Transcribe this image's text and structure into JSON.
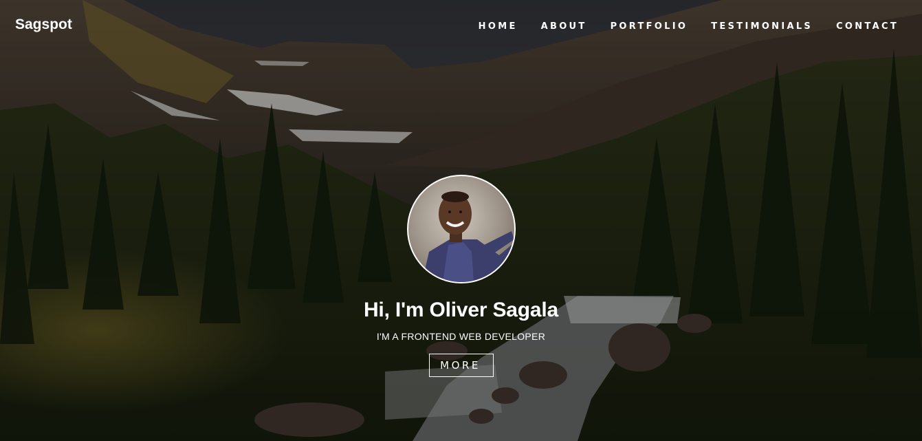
{
  "brand": {
    "name": "Sagspot"
  },
  "nav": {
    "items": [
      {
        "label": "HOME"
      },
      {
        "label": "ABOUT"
      },
      {
        "label": "PORTFOLIO"
      },
      {
        "label": "TESTIMONIALS"
      },
      {
        "label": "CONTACT"
      }
    ]
  },
  "hero": {
    "background": "mountain-forest-waterfall-photo",
    "headline": "Hi, I'm Oliver Sagala",
    "subheadline": "I'M A FRONTEND WEB DEVELOPER",
    "cta_label": "MORE",
    "avatar": "profile-photo"
  },
  "colors": {
    "text": "#ffffff",
    "sky": "#3a3b3f",
    "forest": "#1f2a14"
  }
}
